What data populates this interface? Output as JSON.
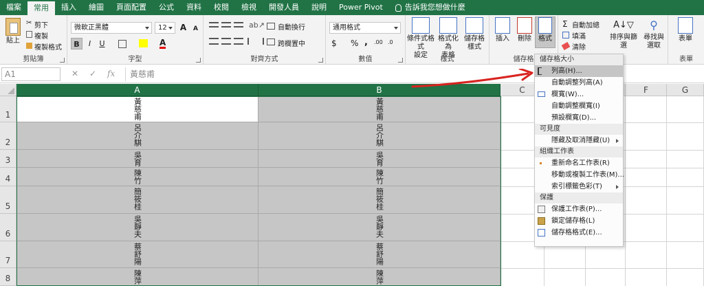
{
  "tabs": [
    "檔案",
    "常用",
    "插入",
    "繪圖",
    "頁面配置",
    "公式",
    "資料",
    "校閱",
    "檢視",
    "開發人員",
    "說明",
    "Power Pivot"
  ],
  "active_tab": "常用",
  "tell_me": "告訴我您想做什麼",
  "ribbon": {
    "clipboard": {
      "paste": "貼上",
      "cut": "剪下",
      "copy": "複製",
      "format_painter": "複製格式",
      "label": "剪貼簿"
    },
    "font": {
      "name": "微軟正黑體",
      "size": "12",
      "bold": "B",
      "italic": "I",
      "underline": "U",
      "grow": "A",
      "shrink": "A",
      "label": "字型"
    },
    "alignment": {
      "wrap": "自動換行",
      "merge": "跨欄置中",
      "label": "對齊方式"
    },
    "number": {
      "format": "通用格式",
      "currency": "$",
      "percent": "%",
      "comma": ",",
      "inc_dec": ".00",
      "dec_dec": ".0",
      "label": "數值"
    },
    "styles": {
      "conditional": "條件式格式",
      "conditional2": "設定",
      "table": "格式化為",
      "table2": "表格",
      "cell": "儲存格",
      "cell2": "樣式",
      "label": "樣式"
    },
    "cells": {
      "insert": "插入",
      "delete": "刪除",
      "format": "格式",
      "label": "儲存格"
    },
    "editing": {
      "autosum": "自動加總",
      "fill": "填滿",
      "clear": "清除",
      "sort": "排序與篩選",
      "find": "尋找與",
      "find2": "選取",
      "label": "編輯"
    },
    "table_group": {
      "table": "表單",
      "label": "表單"
    }
  },
  "formula_bar": {
    "name_box": "A1",
    "fx": "fx",
    "cancel": "✕",
    "enter": "✓",
    "content": "黃慈甫"
  },
  "columns": [
    "A",
    "B",
    "C",
    "D",
    "E",
    "F",
    "G"
  ],
  "rows": [
    {
      "num": "1",
      "a": "黃慈甫",
      "b": "黃慈甫"
    },
    {
      "num": "2",
      "a": "呂介騏",
      "b": "呂介騏"
    },
    {
      "num": "3",
      "a": "吳育",
      "b": "吳育"
    },
    {
      "num": "4",
      "a": "陳竹",
      "b": "陳竹"
    },
    {
      "num": "5",
      "a": "簡筱桂",
      "b": "簡筱桂"
    },
    {
      "num": "6",
      "a": "吳靜夫",
      "b": "吳靜夫"
    },
    {
      "num": "7",
      "a": "蔡舒陽",
      "b": "蔡舒陽"
    },
    {
      "num": "8",
      "a": "陳萍",
      "b": "陳萍"
    }
  ],
  "menu": {
    "sec_size": "儲存格大小",
    "row_height": "列高(H)...",
    "autofit_row": "自動調整列高(A)",
    "col_width": "欄寬(W)...",
    "autofit_col": "自動調整欄寬(I)",
    "default_width": "預設欄寬(D)...",
    "sec_visibility": "可見度",
    "hide_unhide": "隱藏及取消隱藏(U)",
    "sec_organize": "組織工作表",
    "rename": "重新命名工作表(R)",
    "move_copy": "移動或複製工作表(M)...",
    "tab_color": "索引標籤色彩(T)",
    "sec_protect": "保護",
    "protect_sheet": "保護工作表(P)...",
    "lock_cell": "鎖定儲存格(L)",
    "format_cells": "儲存格格式(E)..."
  },
  "colors": {
    "accent": "#217346",
    "arrow": "#d9231f",
    "selection": "#c6c6c6"
  }
}
